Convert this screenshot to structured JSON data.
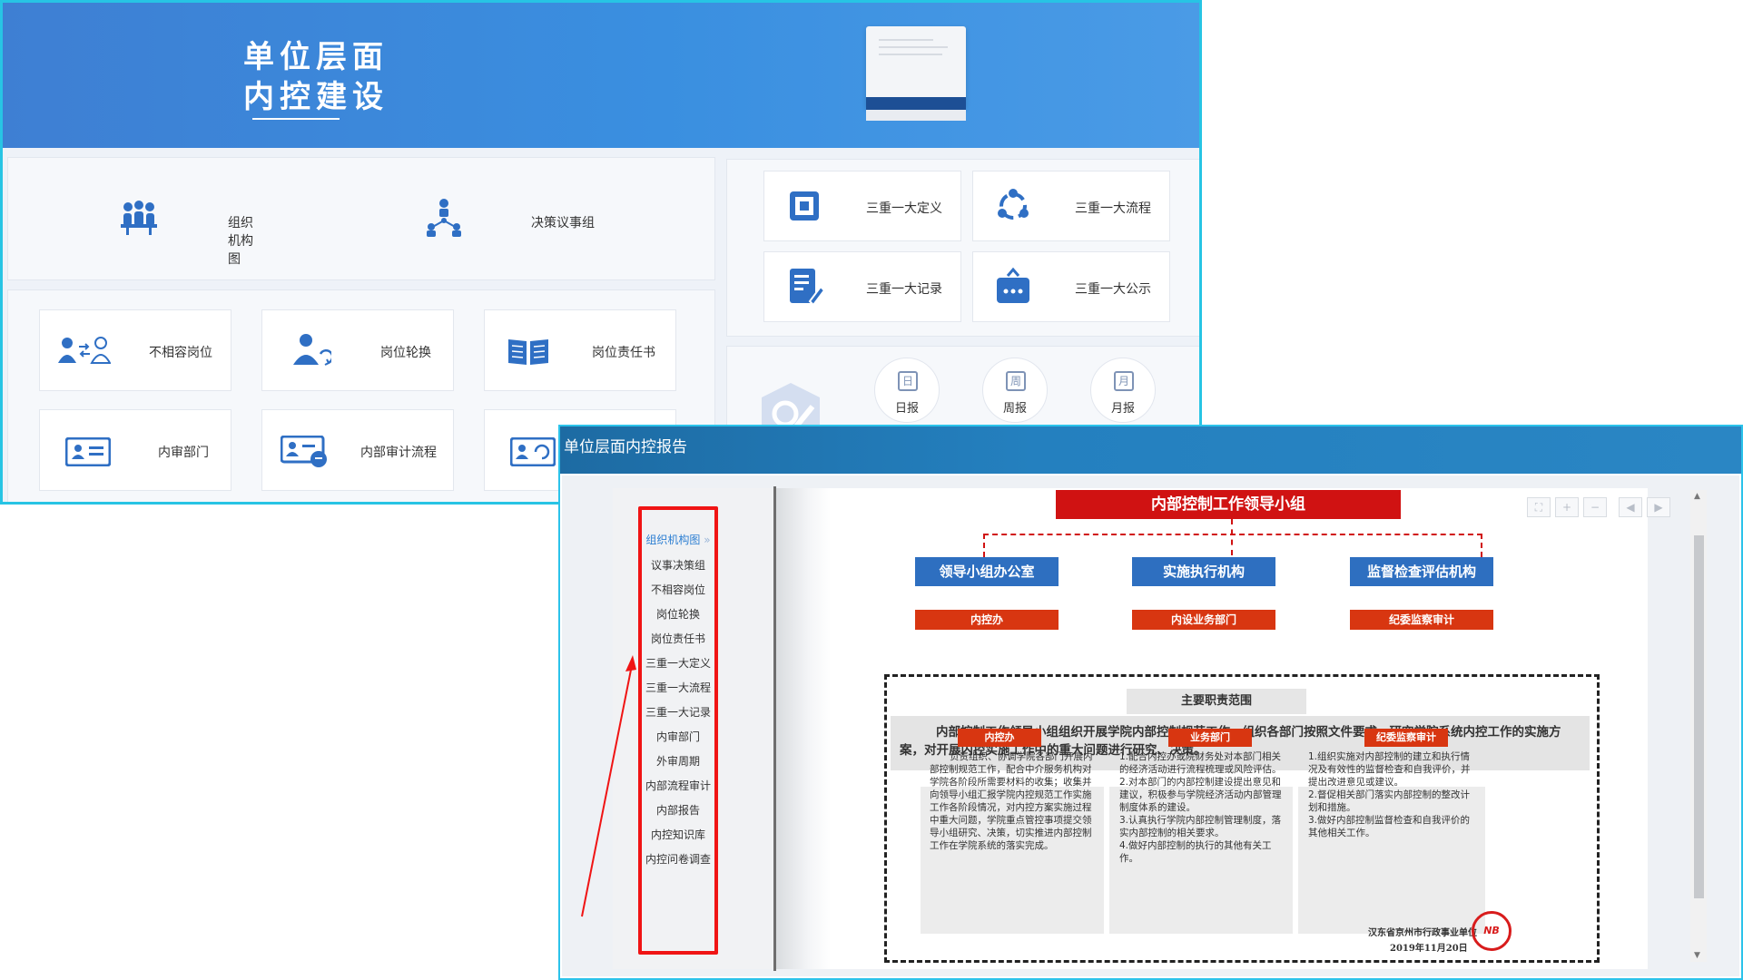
{
  "back": {
    "title_line1": "单位层面",
    "title_line2": "内控建设",
    "top_left": [
      {
        "label": "组织机构图",
        "icon": "org-chart-icon"
      },
      {
        "label": "决策议事组",
        "icon": "hierarchy-icon"
      }
    ],
    "three_major": [
      {
        "label": "三重一大定义",
        "icon": "square-target-icon"
      },
      {
        "label": "三重一大流程",
        "icon": "cycle-icon"
      },
      {
        "label": "三重一大记录",
        "icon": "edit-document-icon"
      },
      {
        "label": "三重一大公示",
        "icon": "chat-bag-icon"
      }
    ],
    "grid": [
      {
        "label": "不相容岗位",
        "icon": "users-swap-icon"
      },
      {
        "label": "岗位轮换",
        "icon": "user-rotate-icon"
      },
      {
        "label": "岗位责任书",
        "icon": "open-book-icon"
      },
      {
        "label": "内审部门",
        "icon": "id-card-icon"
      },
      {
        "label": "内部审计流程",
        "icon": "audit-card-icon"
      },
      {
        "label": "",
        "icon": "refresh-card-icon"
      }
    ],
    "reports": [
      {
        "glyph": "日",
        "label": "日报"
      },
      {
        "glyph": "周",
        "label": "周报"
      },
      {
        "glyph": "月",
        "label": "月报"
      }
    ],
    "colors": {
      "banner": "#3e86d8",
      "border": "#27c4e4",
      "icon_blue": "#2f6fc4"
    }
  },
  "front": {
    "window_title": "单位层面内控报告",
    "nav_items": [
      "组织机构图",
      "议事决策组",
      "不相容岗位",
      "岗位轮换",
      "岗位责任书",
      "三重一大定义",
      "三重一大流程",
      "三重一大记录",
      "内审部门",
      "外审周期",
      "内部流程审计",
      "内部报告",
      "内控知识库",
      "内控问卷调查"
    ],
    "chart": {
      "top_box": "内部控制工作领导小组",
      "branches": [
        {
          "title": "领导小组办公室",
          "sub": "内控办"
        },
        {
          "title": "实施执行机构",
          "sub": "内设业务部门"
        },
        {
          "title": "监督检查评估机构",
          "sub": "纪委监察审计"
        }
      ],
      "scope_title": "主要职责范围",
      "scope_desc": "内部控制工作领导小组组织开展学院内部控制规范工作，组织各部门按照文件要求，研究学院系统内控工作的实施方案，对开展内控实施工作中的重大问题进行研究、决策。",
      "columns": [
        {
          "tag": "内控办",
          "text": "负责组织、协调学院各部门开展内部控制规范工作，配合中介服务机构对学院各阶段所需要材料的收集；收集并向领导小组汇报学院内控规范工作实施工作各阶段情况，对内控方案实施过程中重大问题，学院重点管控事项提交领导小组研究、决策，切实推进内部控制工作在学院系统的落实完成。"
        },
        {
          "tag": "业务部门",
          "text": "1.配合内控办或院财务处对本部门相关的经济活动进行流程梳理或风险评估。\n2.对本部门的内部控制建设提出意见和建议，积极参与学院经济活动内部管理制度体系的建设。\n3.认真执行学院内部控制管理制度，落实内部控制的相关要求。\n4.做好内部控制的执行的其他有关工作。"
        },
        {
          "tag": "纪委监察审计",
          "text": "1.组织实施对内部控制的建立和执行情况及有效性的监督检查和自我评价，并提出改进意见或建议。\n2.督促相关部门落实内部控制的整改计划和措施。\n3.做好内部控制监督检查和自我评价的其他相关工作。"
        }
      ],
      "sign_line1": "汉东省京州市行政事业单位",
      "sign_line2": "2019年11月20日",
      "stamp_text": "NB"
    },
    "colors": {
      "title_bar": "#2480bf",
      "highlight": "#f01414",
      "red_box": "#d01212",
      "blue_box": "#2e6fc0",
      "orange_box": "#d83611"
    }
  }
}
